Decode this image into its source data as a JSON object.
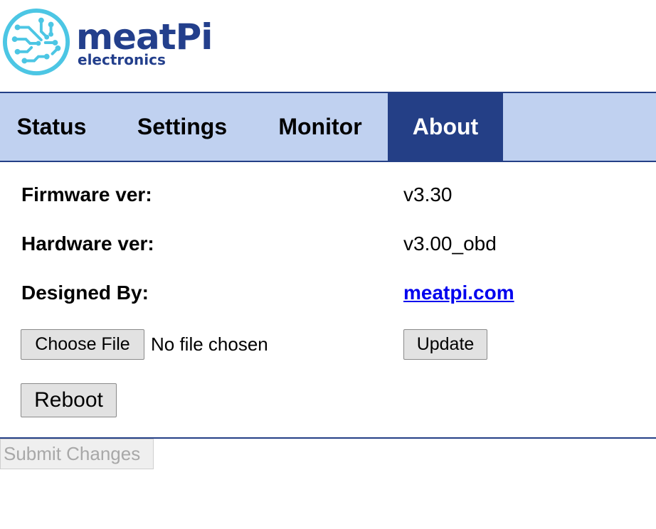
{
  "brand": {
    "name": "meatPi",
    "tagline": "electronics",
    "primary_color": "#233f8c",
    "icon_color": "#4cc6e4"
  },
  "nav": {
    "tabs": [
      {
        "label": "Status",
        "active": false
      },
      {
        "label": "Settings",
        "active": false
      },
      {
        "label": "Monitor",
        "active": false
      },
      {
        "label": "About",
        "active": true
      }
    ],
    "background_color": "#c0d1f0",
    "active_color": "#243f86"
  },
  "about": {
    "firmware": {
      "label": "Firmware ver:",
      "value": "v3.30"
    },
    "hardware": {
      "label": "Hardware ver:",
      "value": "v3.00_obd"
    },
    "designed_by": {
      "label": "Designed By:",
      "value": "meatpi.com"
    }
  },
  "update": {
    "choose_file_label": "Choose File",
    "file_status": "No file chosen",
    "update_label": "Update"
  },
  "reboot_label": "Reboot",
  "submit_label": "Submit Changes"
}
